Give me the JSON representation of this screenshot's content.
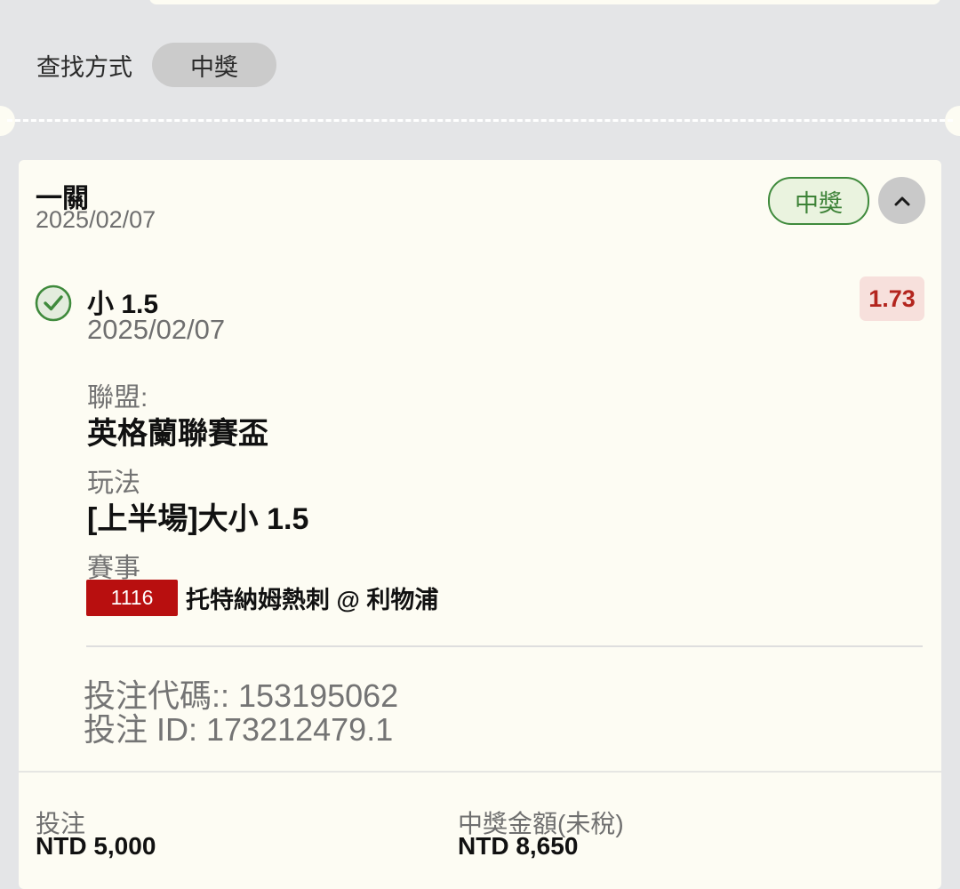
{
  "search": {
    "label": "查找方式",
    "filter": "中獎"
  },
  "card": {
    "bet_type": "一關",
    "date": "2025/02/07",
    "status": "中獎",
    "selection": {
      "name": "小 1.5",
      "date": "2025/02/07",
      "odds": "1.73",
      "league_label": "聯盟:",
      "league": "英格蘭聯賽盃",
      "market_label": "玩法",
      "market": "[上半場]大小 1.5",
      "event_label": "賽事",
      "event_code": "1116",
      "event_name": "托特納姆熱刺 @ 利物浦"
    },
    "bet_code": "投注代碼:: 153195062",
    "bet_id": "投注 ID: 173212479.1",
    "stake_label": "投注",
    "stake": "NTD 5,000",
    "payout_label": "中獎金額(未稅)",
    "payout": "NTD 8,650"
  },
  "colors": {
    "background": "#e4e5e7",
    "card": "#fdfcf3",
    "won_green": "#3f8a3c",
    "odds_red": "#b3251e",
    "event_red": "#b80f0f"
  }
}
